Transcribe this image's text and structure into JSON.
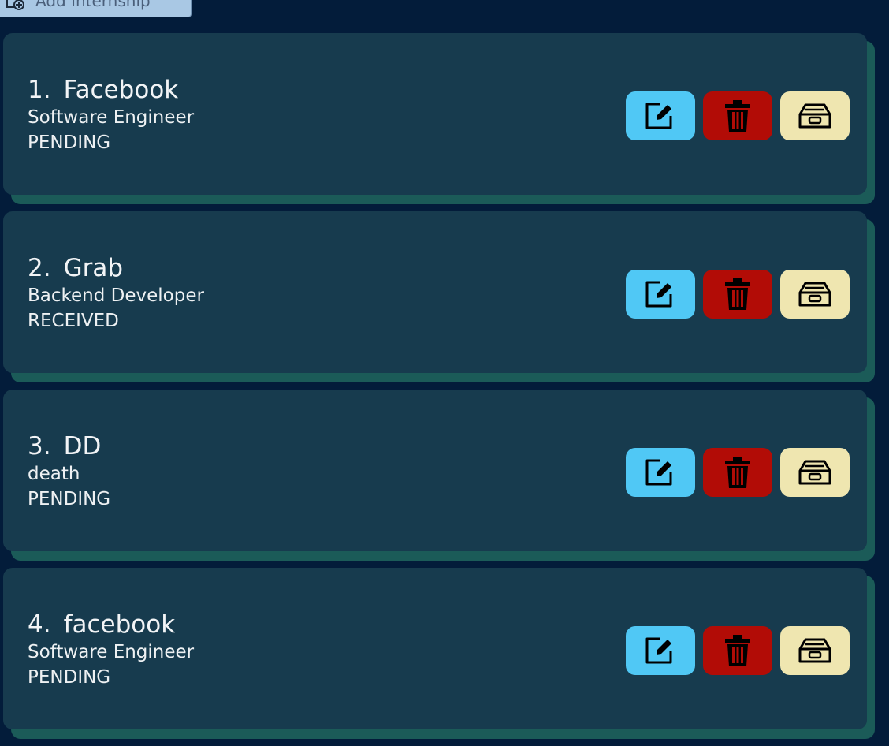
{
  "header": {
    "add_button_label": "Add Internship",
    "add_icon": "add-document-icon"
  },
  "colors": {
    "background": "#031c3a",
    "card": "#173b4e",
    "card_shadow": "#1b5b58",
    "edit_button": "#50c8f5",
    "delete_button": "#b20c06",
    "archive_button": "#efe6b0"
  },
  "internships": [
    {
      "index": "1.",
      "company": "Facebook",
      "role": "Software Engineer",
      "status": "PENDING"
    },
    {
      "index": "2.",
      "company": "Grab",
      "role": "Backend Developer",
      "status": "RECEIVED"
    },
    {
      "index": "3.",
      "company": "DD",
      "role": "death",
      "status": "PENDING"
    },
    {
      "index": "4.",
      "company": "facebook",
      "role": "Software Engineer",
      "status": "PENDING"
    }
  ],
  "icons": {
    "edit": "edit-icon",
    "delete": "trash-icon",
    "archive": "archive-icon"
  }
}
